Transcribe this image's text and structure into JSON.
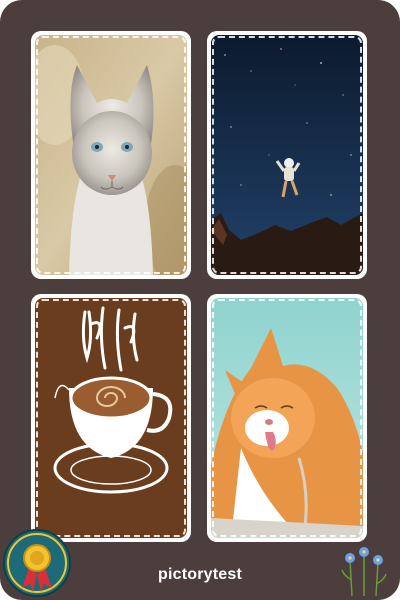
{
  "app": {
    "title": "pictorytest"
  },
  "cards": [
    {
      "image": "gray-cat-photo"
    },
    {
      "image": "astronaut-night-sky-photo"
    },
    {
      "image": "java-coffee-cup-illustration"
    },
    {
      "image": "ginger-cat-licking-photo"
    }
  ],
  "icons": {
    "badge": "gold-medal-ribbon-icon",
    "decoration": "blue-flowers-icon"
  },
  "colors": {
    "background": "#4b3e3d",
    "card_border": "#ffffff",
    "coffee_bg": "#6b3d1f",
    "accent_gold": "#f2c430",
    "accent_teal": "#1d6b78"
  }
}
